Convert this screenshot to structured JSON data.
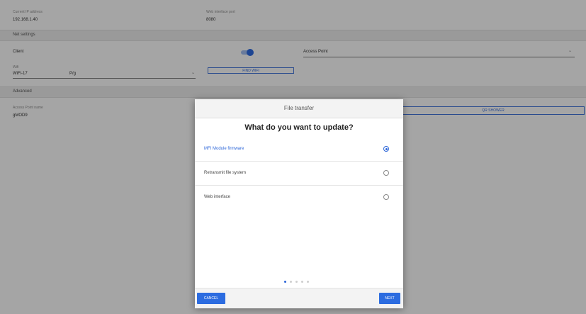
{
  "background": {
    "fields": {
      "ip_address_label": "Current IP address",
      "ip_address_value": "192.168.1.40",
      "port_label": "Web interface port",
      "port_value": "8080"
    },
    "sections": {
      "net_settings": "Net settings",
      "advanced": "Advanced"
    },
    "net": {
      "client_label": "Client",
      "client_toggle_on": true,
      "access_point_label": "Access Point",
      "wifi_label": "Wifi",
      "wifi_value": "WiFi-17",
      "wifi_extra": "P/g",
      "find_wifi_button": "FIND WIFI",
      "chevron": "⌄"
    },
    "advanced": {
      "ssid_label": "Access Point name",
      "ssid_value": "gMOD9",
      "qr_button": "QR SHOWER"
    }
  },
  "dialog": {
    "title": "File transfer",
    "question": "What do you want to update?",
    "options": [
      {
        "label": "MFI Module firmware",
        "selected": true
      },
      {
        "label": "Retransmit file system",
        "selected": false
      },
      {
        "label": "Web interface",
        "selected": false
      }
    ],
    "pages_total": 5,
    "page_current": 1,
    "cancel_label": "CANCEL",
    "next_label": "NEXT"
  },
  "colors": {
    "accent": "#2c6ce0",
    "overlay": "rgba(0,0,0,0.32)"
  }
}
